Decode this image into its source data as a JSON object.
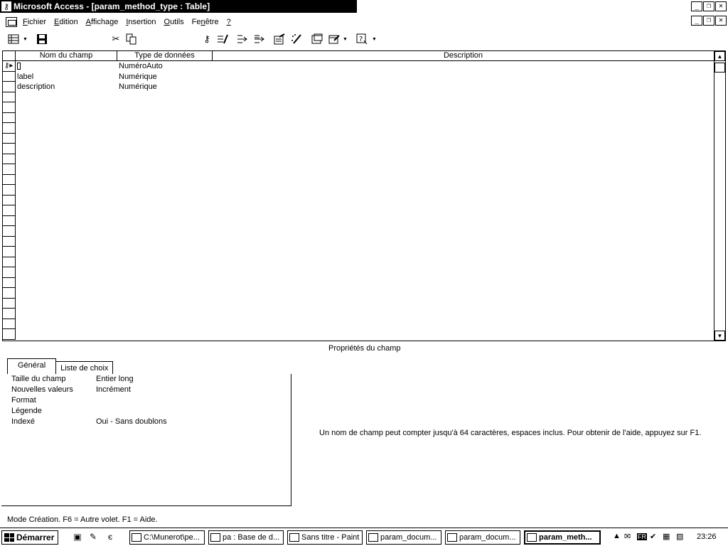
{
  "window": {
    "title": "Microsoft Access - [param_method_type : Table]"
  },
  "menubar": {
    "items": [
      "Fichier",
      "Edition",
      "Affichage",
      "Insertion",
      "Outils",
      "Fenêtre",
      "?"
    ]
  },
  "toolbar": {
    "icons": [
      "view-icon",
      "save-icon",
      "cut-icon",
      "copy-icon",
      "primary-key-icon",
      "indexes-icon",
      "insert-rows-icon",
      "delete-rows-icon",
      "properties-icon",
      "build-icon",
      "database-window-icon",
      "new-object-icon",
      "help-icon"
    ]
  },
  "grid": {
    "headers": [
      "Nom du champ",
      "Type de données",
      "Description"
    ],
    "rows": [
      {
        "name": "",
        "type": "NuméroAuto",
        "primary_key": true
      },
      {
        "name": "label",
        "type": "Numérique"
      },
      {
        "name": "description",
        "type": "Numérique"
      }
    ]
  },
  "properties": {
    "title": "Propriétés du champ",
    "tabs": [
      "Général",
      "Liste de choix"
    ],
    "active_tab": "Général",
    "rows": [
      {
        "label": "Taille du champ",
        "value": "Entier long"
      },
      {
        "label": "Nouvelles valeurs",
        "value": "Incrément"
      },
      {
        "label": "Format",
        "value": ""
      },
      {
        "label": "Légende",
        "value": ""
      },
      {
        "label": "Indexé",
        "value": "Oui - Sans doublons"
      }
    ],
    "hint": "Un nom de champ peut compter jusqu'à 64 caractères, espaces inclus. Pour obtenir de l'aide, appuyez sur F1."
  },
  "status": {
    "text": "Mode Création. F6 = Autre volet. F1 = Aide."
  },
  "taskbar": {
    "start_label": "Démarrer",
    "tasks": [
      {
        "label": "C:\\Munerot\\pe...",
        "active": false
      },
      {
        "label": "pa : Base de d...",
        "active": false
      },
      {
        "label": "Sans titre - Paint",
        "active": false
      },
      {
        "label": "param_docum...",
        "active": false
      },
      {
        "label": "param_docum...",
        "active": false
      },
      {
        "label": "param_meth...",
        "active": true
      }
    ],
    "language": "FR",
    "clock": "23:26"
  }
}
